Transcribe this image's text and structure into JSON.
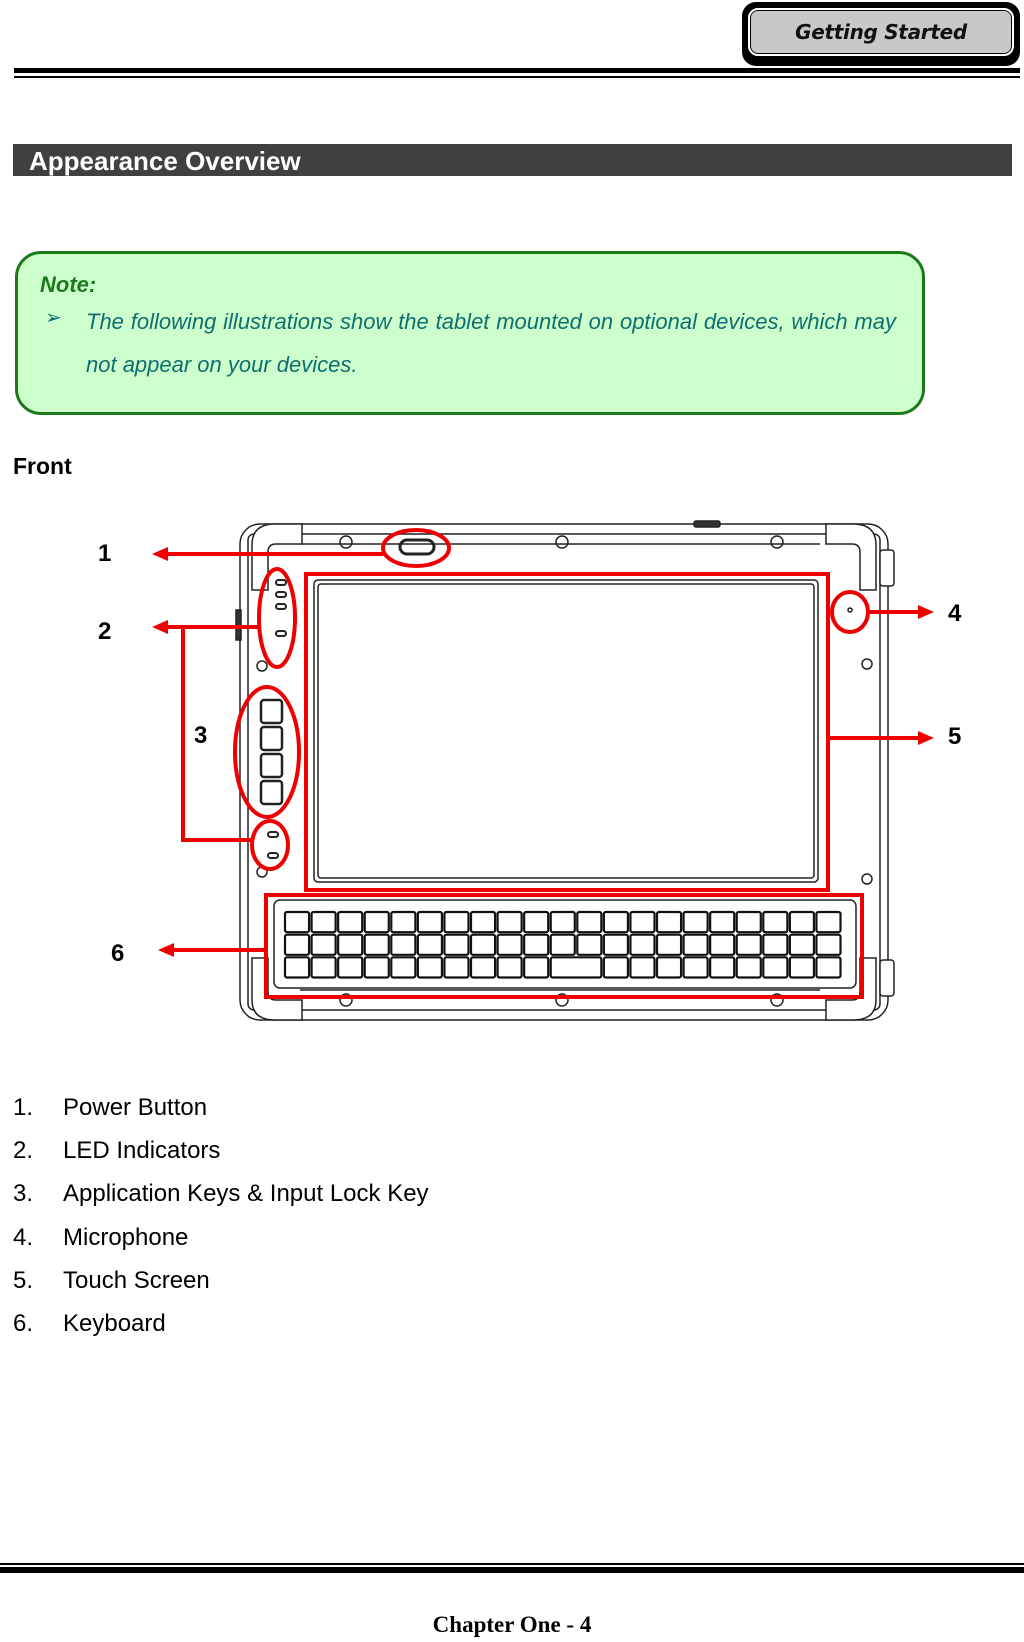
{
  "header": {
    "section_tab": "Getting Started"
  },
  "section": {
    "title": "Appearance Overview"
  },
  "note": {
    "title": "Note:",
    "bullet_icon": "arrowhead-bullet-icon",
    "bullet_glyph": "➢",
    "text": "The following illustrations show the tablet mounted on optional devices, which may not appear on your devices."
  },
  "front": {
    "heading": "Front",
    "callouts": [
      "1",
      "2",
      "3",
      "4",
      "5",
      "6"
    ],
    "keyboard": {
      "rows": 3,
      "keys_per_row": 21,
      "spacebar_width_keys": 2
    },
    "app_keys_count": 4,
    "led_count": 4,
    "highlight_color": "#ee0000"
  },
  "components": [
    {
      "number": "1.",
      "label": "Power Button"
    },
    {
      "number": "2.",
      "label": "LED Indicators"
    },
    {
      "number": "3.",
      "label": "Application Keys & Input Lock Key"
    },
    {
      "number": "4.",
      "label": "Microphone"
    },
    {
      "number": "5.",
      "label": "Touch Screen"
    },
    {
      "number": "6.",
      "label": "Keyboard"
    }
  ],
  "footer": {
    "page_label": "Chapter One - 4"
  }
}
